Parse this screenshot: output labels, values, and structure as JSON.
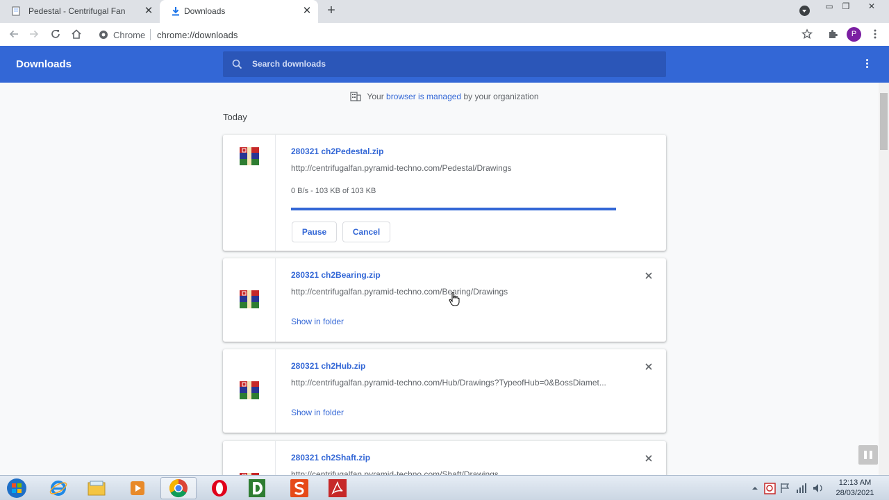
{
  "tabs": [
    {
      "title": "Pedestal - Centrifugal Fan",
      "active": false
    },
    {
      "title": "Downloads",
      "active": true
    }
  ],
  "toolbar": {
    "omnibox_label": "Chrome",
    "url": "chrome://downloads",
    "avatar_letter": "P"
  },
  "header": {
    "title": "Downloads",
    "search_placeholder": "Search downloads"
  },
  "managed_notice": {
    "prefix": "Your",
    "link": "browser is managed",
    "suffix": "by your organization"
  },
  "section_date": "Today",
  "downloads": [
    {
      "filename": "280321 ch2Pedestal.zip",
      "url": "http://centrifugalfan.pyramid-techno.com/Pedestal/Drawings",
      "status": "0 B/s - 103 KB of 103 KB",
      "progress_percent": 100,
      "pause_label": "Pause",
      "cancel_label": "Cancel"
    },
    {
      "filename": "280321 ch2Bearing.zip",
      "url": "http://centrifugalfan.pyramid-techno.com/Bearing/Drawings",
      "action_label": "Show in folder"
    },
    {
      "filename": "280321 ch2Hub.zip",
      "url": "http://centrifugalfan.pyramid-techno.com/Hub/Drawings?TypeofHub=0&BossDiamet...",
      "action_label": "Show in folder"
    },
    {
      "filename": "280321 ch2Shaft.zip",
      "url": "http://centrifugalfan.pyramid-techno.com/Shaft/Drawings"
    }
  ],
  "taskbar": {
    "time": "12:13 AM",
    "date": "28/03/2021"
  },
  "colors": {
    "header_blue": "#3367d6",
    "search_blue": "#2b56b8",
    "link_blue": "#3367d6"
  }
}
